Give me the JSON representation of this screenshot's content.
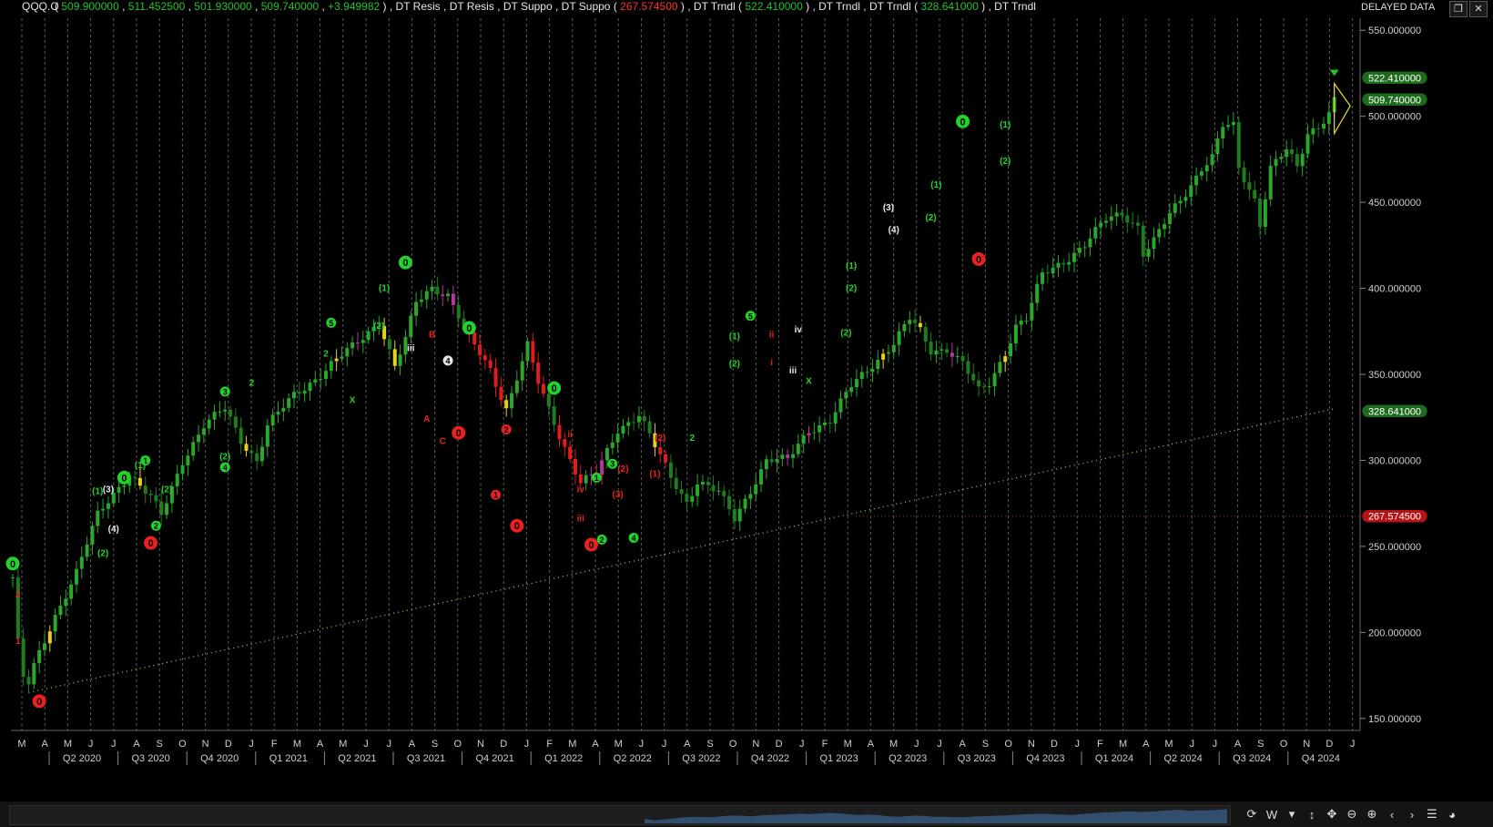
{
  "header": {
    "symbol": "QQQ.O",
    "open": "509.900000",
    "high": "511.452500",
    "low": "501.930000",
    "close": "509.740000",
    "change": "+3.949982",
    "studies": [
      "DT Resis",
      "DT Resis",
      "DT Suppo",
      "DT Suppo"
    ],
    "suppo_value": "267.574500",
    "trndl1": "DT Trndl",
    "trndl1_value": "522.410000",
    "trndl2": "DT Trndl",
    "trndl3": "DT Trndl",
    "trndl3_value": "328.641000",
    "trndl4": "DT Trndl",
    "delayed": "DELAYED DATA",
    "colors": {
      "green": "#22c32a",
      "red": "#ff3030",
      "white": "#e6e6e6"
    }
  },
  "chart_data": {
    "type": "candlestick",
    "interval": "weekly",
    "y_ticks": [
      150,
      200,
      250,
      300,
      350,
      400,
      450,
      500,
      550
    ],
    "y_tick_labels": [
      "150.000000",
      "200.000000",
      "250.000000",
      "300.000000",
      "350.000000",
      "400.000000",
      "450.000000",
      "500.000000",
      "550.000000"
    ],
    "ylim": [
      143,
      557
    ],
    "month_labels": [
      "M",
      "A",
      "M",
      "J",
      "J",
      "A",
      "S",
      "O",
      "N",
      "D",
      "J",
      "F",
      "M",
      "A",
      "M",
      "J",
      "J",
      "A",
      "S",
      "O",
      "N",
      "D",
      "J",
      "F",
      "M",
      "A",
      "M",
      "J",
      "J",
      "A",
      "S",
      "O",
      "N",
      "D",
      "J",
      "F",
      "M",
      "A",
      "M",
      "J",
      "J",
      "A",
      "S",
      "O",
      "N",
      "D",
      "J",
      "F",
      "M",
      "A",
      "M",
      "J",
      "J",
      "A",
      "S",
      "O",
      "N",
      "D",
      "J"
    ],
    "quarter_labels": [
      "Q2 2020",
      "Q3 2020",
      "Q4 2020",
      "Q1 2021",
      "Q2 2021",
      "Q3 2021",
      "Q4 2021",
      "Q1 2022",
      "Q2 2022",
      "Q3 2022",
      "Q4 2022",
      "Q1 2023",
      "Q2 2023",
      "Q3 2023",
      "Q4 2023",
      "Q1 2024",
      "Q2 2024",
      "Q3 2024",
      "Q4 2024"
    ],
    "price_path": [
      [
        0,
        232
      ],
      [
        1.5,
        175
      ],
      [
        3,
        170
      ],
      [
        4,
        180
      ],
      [
        8,
        210
      ],
      [
        12,
        235
      ],
      [
        16,
        268
      ],
      [
        20,
        285
      ],
      [
        22,
        292
      ],
      [
        26,
        278
      ],
      [
        28,
        268
      ],
      [
        32,
        300
      ],
      [
        36,
        320
      ],
      [
        40,
        330
      ],
      [
        43,
        312
      ],
      [
        46,
        300
      ],
      [
        48,
        320
      ],
      [
        53,
        338
      ],
      [
        58,
        350
      ],
      [
        64,
        366
      ],
      [
        69,
        381
      ],
      [
        72,
        354
      ],
      [
        74,
        370
      ],
      [
        76,
        392
      ],
      [
        79,
        401
      ],
      [
        82,
        396
      ],
      [
        86,
        371
      ],
      [
        90,
        353
      ],
      [
        93,
        330
      ],
      [
        97,
        366
      ],
      [
        99,
        345
      ],
      [
        103,
        315
      ],
      [
        107,
        287
      ],
      [
        110,
        292
      ],
      [
        114,
        318
      ],
      [
        118,
        327
      ],
      [
        121,
        308
      ],
      [
        124,
        290
      ],
      [
        127,
        276
      ],
      [
        129,
        288
      ],
      [
        133,
        281
      ],
      [
        136,
        266
      ],
      [
        139,
        283
      ],
      [
        142,
        300
      ],
      [
        146,
        300
      ],
      [
        150,
        318
      ],
      [
        154,
        323
      ],
      [
        158,
        343
      ],
      [
        162,
        356
      ],
      [
        166,
        368
      ],
      [
        169,
        382
      ],
      [
        171,
        375
      ],
      [
        173,
        364
      ],
      [
        176,
        365
      ],
      [
        179,
        356
      ],
      [
        182,
        340
      ],
      [
        184,
        345
      ],
      [
        187,
        363
      ],
      [
        189,
        378
      ],
      [
        191,
        382
      ],
      [
        194,
        408
      ],
      [
        198,
        416
      ],
      [
        202,
        425
      ],
      [
        206,
        440
      ],
      [
        209,
        444
      ],
      [
        212,
        436
      ],
      [
        213,
        420
      ],
      [
        215,
        427
      ],
      [
        218,
        443
      ],
      [
        221,
        456
      ],
      [
        224,
        470
      ],
      [
        226,
        476
      ],
      [
        228,
        494
      ],
      [
        230,
        494
      ],
      [
        231,
        470
      ],
      [
        234,
        452
      ],
      [
        235,
        438
      ],
      [
        237,
        470
      ],
      [
        240,
        480
      ],
      [
        242,
        470
      ],
      [
        244,
        490
      ],
      [
        246,
        495
      ],
      [
        248,
        502
      ],
      [
        249,
        509.74
      ]
    ],
    "callouts": [
      {
        "y": 522.41,
        "text": "522.410000",
        "color": "#1e6b1e"
      },
      {
        "y": 509.74,
        "text": "509.740000",
        "color": "#1e6b1e"
      },
      {
        "y": 328.641,
        "text": "328.641000",
        "color": "#1e6b1e"
      },
      {
        "y": 267.5745,
        "text": "267.574500",
        "color": "#b51414"
      }
    ],
    "support_level": 267.5745,
    "trendline": {
      "from": [
        3,
        165
      ],
      "to": [
        249,
        330
      ]
    },
    "triangle": {
      "apex": [
        252,
        506
      ],
      "top": [
        249,
        519
      ],
      "bottom": [
        249,
        490
      ]
    },
    "wave_labels": [
      {
        "i": 0,
        "y": 240,
        "t": "0",
        "c": "g",
        "circle": true
      },
      {
        "i": 5,
        "y": 160,
        "t": "0",
        "c": "r",
        "circle": true
      },
      {
        "i": 1,
        "y": 222,
        "t": "2",
        "c": "r"
      },
      {
        "i": 1,
        "y": 195,
        "t": "1",
        "c": "r"
      },
      {
        "i": 21,
        "y": 290,
        "t": "0",
        "c": "g",
        "circle": true
      },
      {
        "i": 26,
        "y": 252,
        "t": "0",
        "c": "r",
        "circle": true
      },
      {
        "i": 25,
        "y": 300,
        "t": "1",
        "c": "g",
        "circle": true
      },
      {
        "i": 27,
        "y": 262,
        "t": "2",
        "c": "g",
        "circle": true
      },
      {
        "i": 16,
        "y": 282,
        "t": "(1)",
        "c": "g"
      },
      {
        "i": 24,
        "y": 297,
        "t": "(1)",
        "c": "g"
      },
      {
        "i": 18,
        "y": 283,
        "t": "(3)",
        "c": "w"
      },
      {
        "i": 19,
        "y": 260,
        "t": "(4)",
        "c": "w"
      },
      {
        "i": 17,
        "y": 246,
        "t": "(2)",
        "c": "g"
      },
      {
        "i": 29,
        "y": 283,
        "t": "(2)",
        "c": "g"
      },
      {
        "i": 40,
        "y": 340,
        "t": "3",
        "c": "g",
        "circle": true
      },
      {
        "i": 40,
        "y": 296,
        "t": "4",
        "c": "g",
        "circle": true
      },
      {
        "i": 40,
        "y": 302,
        "t": "(2)",
        "c": "g"
      },
      {
        "i": 60,
        "y": 380,
        "t": "5",
        "c": "g",
        "circle": true
      },
      {
        "i": 64,
        "y": 335,
        "t": "X",
        "c": "g"
      },
      {
        "i": 59,
        "y": 362,
        "t": "2",
        "c": "g"
      },
      {
        "i": 45,
        "y": 345,
        "t": "2",
        "c": "g"
      },
      {
        "i": 74,
        "y": 415,
        "t": "0",
        "c": "g",
        "circle": true
      },
      {
        "i": 70,
        "y": 400,
        "t": "(1)",
        "c": "g"
      },
      {
        "i": 69,
        "y": 378,
        "t": "(2)",
        "c": "g"
      },
      {
        "i": 75,
        "y": 365,
        "t": "iii",
        "c": "w"
      },
      {
        "i": 79,
        "y": 373,
        "t": "B",
        "c": "r"
      },
      {
        "i": 82,
        "y": 358,
        "t": "4",
        "c": "w",
        "circle": true
      },
      {
        "i": 78,
        "y": 324,
        "t": "A",
        "c": "r"
      },
      {
        "i": 81,
        "y": 311,
        "t": "C",
        "c": "r"
      },
      {
        "i": 86,
        "y": 377,
        "t": "0",
        "c": "g",
        "circle": true
      },
      {
        "i": 84,
        "y": 316,
        "t": "0",
        "c": "r",
        "circle": true
      },
      {
        "i": 93,
        "y": 318,
        "t": "2",
        "c": "r",
        "circle": true
      },
      {
        "i": 91,
        "y": 280,
        "t": "1",
        "c": "r",
        "circle": true
      },
      {
        "i": 95,
        "y": 262,
        "t": "0",
        "c": "r",
        "circle": true
      },
      {
        "i": 102,
        "y": 342,
        "t": "0",
        "c": "g",
        "circle": true
      },
      {
        "i": 105,
        "y": 315,
        "t": "ii",
        "c": "r"
      },
      {
        "i": 107,
        "y": 283,
        "t": "iv",
        "c": "r"
      },
      {
        "i": 107,
        "y": 266,
        "t": "iii",
        "c": "r"
      },
      {
        "i": 109,
        "y": 251,
        "t": "0",
        "c": "r",
        "circle": true
      },
      {
        "i": 113,
        "y": 298,
        "t": "3",
        "c": "g",
        "circle": true
      },
      {
        "i": 110,
        "y": 290,
        "t": "1",
        "c": "g",
        "circle": true
      },
      {
        "i": 111,
        "y": 254,
        "t": "2",
        "c": "g",
        "circle": true
      },
      {
        "i": 117,
        "y": 255,
        "t": "4",
        "c": "g",
        "circle": true
      },
      {
        "i": 115,
        "y": 295,
        "t": "(2)",
        "c": "r"
      },
      {
        "i": 114,
        "y": 280,
        "t": "(3)",
        "c": "r"
      },
      {
        "i": 122,
        "y": 313,
        "t": "(2)",
        "c": "r"
      },
      {
        "i": 121,
        "y": 292,
        "t": "(1)",
        "c": "r"
      },
      {
        "i": 128,
        "y": 313,
        "t": "2",
        "c": "g"
      },
      {
        "i": 139,
        "y": 384,
        "t": "5",
        "c": "g",
        "circle": true
      },
      {
        "i": 136,
        "y": 372,
        "t": "(1)",
        "c": "g"
      },
      {
        "i": 136,
        "y": 356,
        "t": "(2)",
        "c": "g"
      },
      {
        "i": 143,
        "y": 373,
        "t": "ii",
        "c": "r"
      },
      {
        "i": 143,
        "y": 357,
        "t": "i",
        "c": "r"
      },
      {
        "i": 148,
        "y": 376,
        "t": "iv",
        "c": "w"
      },
      {
        "i": 147,
        "y": 352,
        "t": "iii",
        "c": "w"
      },
      {
        "i": 150,
        "y": 346,
        "t": "X",
        "c": "g"
      },
      {
        "i": 157,
        "y": 374,
        "t": "(2)",
        "c": "g"
      },
      {
        "i": 165,
        "y": 447,
        "t": "(3)",
        "c": "w"
      },
      {
        "i": 166,
        "y": 434,
        "t": "(4)",
        "c": "w"
      },
      {
        "i": 158,
        "y": 400,
        "t": "(2)",
        "c": "g"
      },
      {
        "i": 158,
        "y": 413,
        "t": "(1)",
        "c": "g"
      },
      {
        "i": 179,
        "y": 497,
        "t": "0",
        "c": "g",
        "circle": true
      },
      {
        "i": 182,
        "y": 417,
        "t": "0",
        "c": "r",
        "circle": true
      },
      {
        "i": 174,
        "y": 460,
        "t": "(1)",
        "c": "g"
      },
      {
        "i": 173,
        "y": 441,
        "t": "(2)",
        "c": "g"
      },
      {
        "i": 187,
        "y": 495,
        "t": "(1)",
        "c": "g"
      },
      {
        "i": 187,
        "y": 474,
        "t": "(2)",
        "c": "g"
      }
    ]
  },
  "toolbar": {
    "refresh": "⟳",
    "interval": "W",
    "dropdown": "▾",
    "items": [
      "↕",
      "✥",
      "⊖",
      "⊕",
      "‹",
      "›",
      "☰",
      "◕"
    ]
  }
}
